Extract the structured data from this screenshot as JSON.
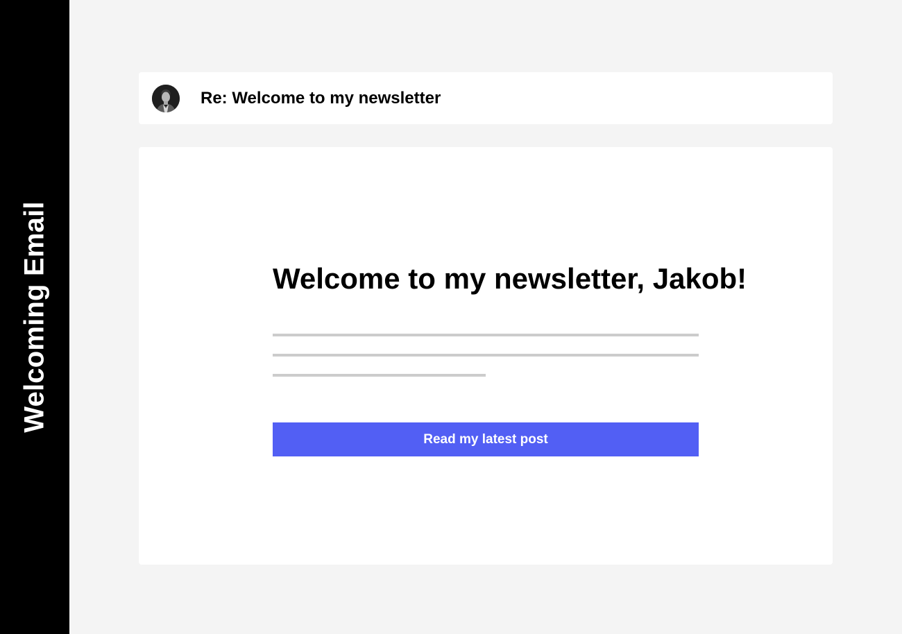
{
  "sidebar": {
    "label": "Welcoming Email",
    "background": "#000000"
  },
  "email_header": {
    "avatar_icon": "person-avatar-icon",
    "subject": "Re: Welcome to my newsletter"
  },
  "email_body": {
    "heading": "Welcome to my newsletter, Jakob!",
    "placeholder_line_color": "#cccccc",
    "cta_label": "Read my latest post",
    "cta_color": "#525ff4"
  }
}
